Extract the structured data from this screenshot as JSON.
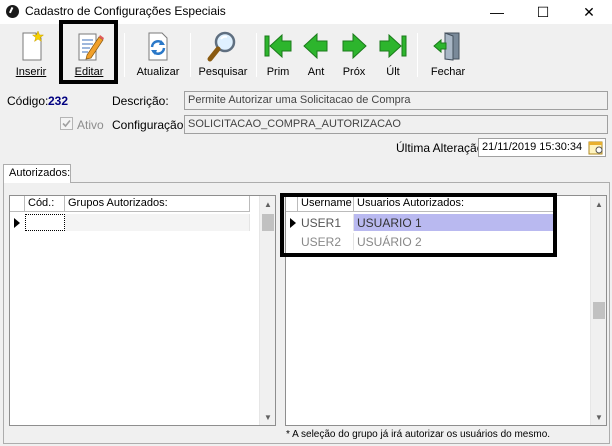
{
  "window": {
    "title": "Cadastro de Configurações Especiais",
    "controls": [
      "—",
      "☐",
      "✕"
    ]
  },
  "toolbar": {
    "inserir": "Inserir",
    "editar": "Editar",
    "atualizar": "Atualizar",
    "pesquisar": "Pesquisar",
    "prim": "Prim",
    "ant": "Ant",
    "prox": "Próx",
    "ult": "Últ",
    "fechar": "Fechar"
  },
  "form": {
    "codigo_label": "Código:",
    "codigo_value": "232",
    "descricao_label": "Descrição:",
    "descricao_value": "Permite Autorizar uma Solicitacao de Compra",
    "ativo_label": "Ativo",
    "ativo_checked": true,
    "configuracao_label": "Configuração:",
    "configuracao_value": "SOLICITACAO_COMPRA_AUTORIZACAO",
    "ultima_alteracao_label": "Última Alteração:",
    "ultima_alteracao_value": "21/11/2019 15:30:34"
  },
  "tabs": {
    "autorizados": "Autorizados:"
  },
  "groups_grid": {
    "columns": [
      "Cód.:",
      "Grupos Autorizados:"
    ],
    "rows": [
      {
        "cod": "",
        "grupo": ""
      }
    ]
  },
  "users_grid": {
    "columns": [
      "Username",
      "Usuarios Autorizados:"
    ],
    "rows": [
      {
        "username": "USER1",
        "usuario": "USUARIO 1",
        "selected": true
      },
      {
        "username": "USER2",
        "usuario": "USUÁRIO 2",
        "selected": false
      }
    ]
  },
  "footnote": "* A seleção do grupo já irá autorizar os usuários do mesmo.",
  "colors": {
    "selected_row": "#b9b9f0",
    "codigo_value": "#000080",
    "nav_green": "#2db52d"
  }
}
